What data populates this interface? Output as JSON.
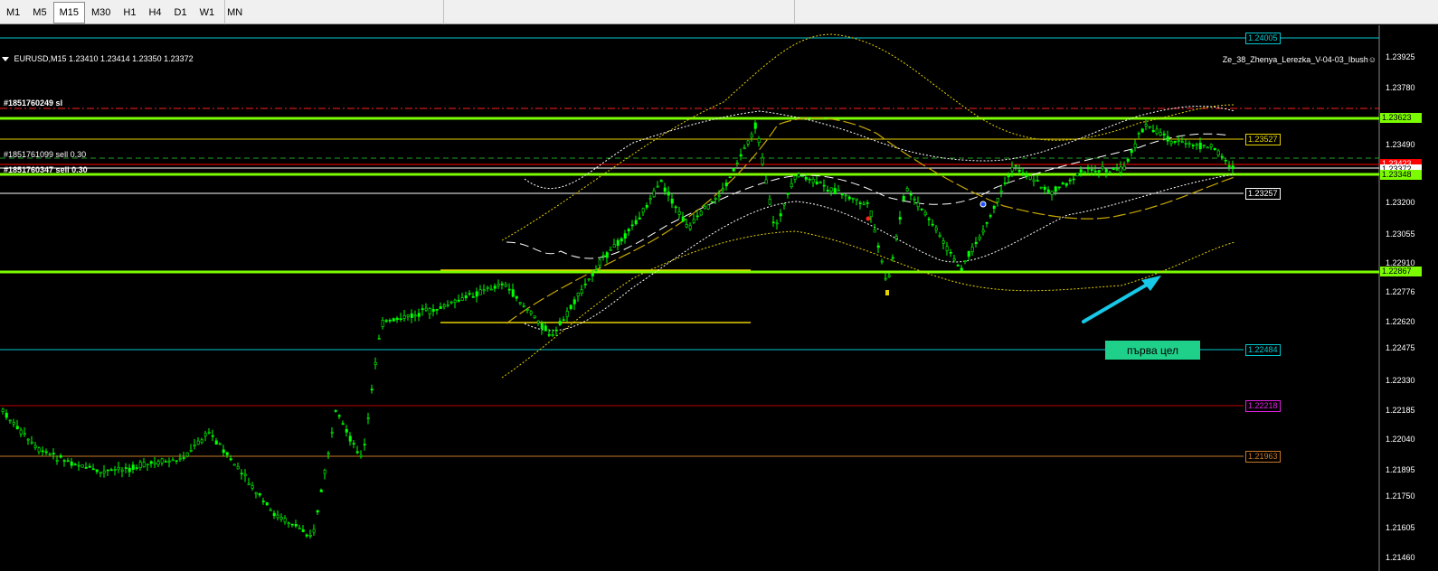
{
  "toolbar": {
    "timeframes": [
      "M1",
      "M5",
      "M15",
      "M30",
      "H1",
      "H4",
      "D1",
      "W1",
      "MN"
    ],
    "active_timeframe": "M15"
  },
  "chart_header": {
    "symbol_line": "EURUSD,M15  1.23410 1.23414 1.23350 1.23372",
    "indicator": "Ze_38_Zhenya_Lerezka_V-04-03_Ibush☺"
  },
  "orders": {
    "sl_label": "#1851760249 sl",
    "sell1_label": "#1851761099 sell 0.30",
    "sell2_label": "#1851760347 sell 0.30"
  },
  "price_levels": {
    "top_cyan": "1.24005",
    "green_top": "1.23623",
    "yellow": "1.23527",
    "red_small": "1.23423",
    "white_a": "1.23372",
    "green_mid": "1.23348",
    "white_b": "1.23257",
    "green_low": "1.22867",
    "cyan_low": "1.22484",
    "red_low": "1.22218",
    "orange_low": "1.21963"
  },
  "axis_ticks": [
    "1.23925",
    "1.23780",
    "1.23490",
    "1.23200",
    "1.23055",
    "1.22910",
    "1.22776",
    "1.22620",
    "1.22475",
    "1.22330",
    "1.22185",
    "1.22040",
    "1.21895",
    "1.21750",
    "1.21605",
    "1.21460"
  ],
  "annotation": {
    "target_label": "първа цел"
  },
  "colors": {
    "green_line": "#7cfc00",
    "candle": "#00ff00",
    "yellow_line": "#ffff00",
    "cyan_line": "#00c8d0",
    "red_line": "#ff0000",
    "orange_line": "#c87828",
    "arrow": "#18c8e8",
    "target_box": "#1fd08a"
  }
}
